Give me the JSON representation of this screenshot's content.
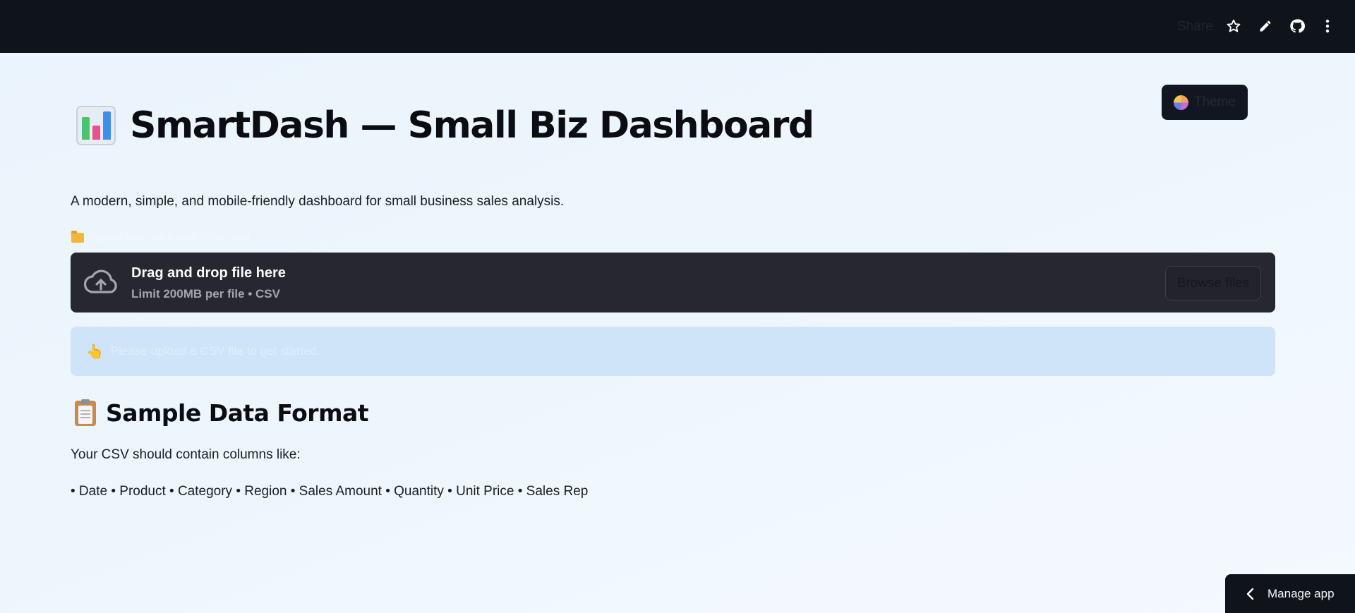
{
  "topbar": {
    "share_label": "Share",
    "icons": [
      "star-icon",
      "pencil-icon",
      "github-icon",
      "more-vert-icon"
    ]
  },
  "theme_button": {
    "label": "Theme",
    "icon": "theme-palette-icon"
  },
  "header": {
    "title": "SmartDash — Small Biz Dashboard",
    "title_icon": "bar-chart-icon",
    "subtitle": "A modern, simple, and mobile-friendly dashboard for small business sales analysis."
  },
  "uploader": {
    "label": "Upload your sales data (CSV only)",
    "label_icon": "folder-icon",
    "drop_title": "Drag and drop file here",
    "drop_subtitle": "Limit 200MB per file • CSV",
    "browse_label": "Browse files",
    "cloud_icon": "cloud-upload-icon"
  },
  "info": {
    "text": "Please upload a CSV file to get started.",
    "icon": "pointing-hand-icon"
  },
  "sample": {
    "title": "Sample Data Format",
    "icon": "clipboard-icon",
    "note": "Your CSV should contain columns like:",
    "columns": "• Date • Product • Category • Region • Sales Amount • Quantity • Unit Price • Sales Rep"
  },
  "manage_app": {
    "label": "Manage app"
  },
  "colors": {
    "topbar_bg": "#0f131a",
    "page_bg": "#eef6fd",
    "dropzone_bg": "#262730",
    "info_bg": "#cfe4f9"
  }
}
